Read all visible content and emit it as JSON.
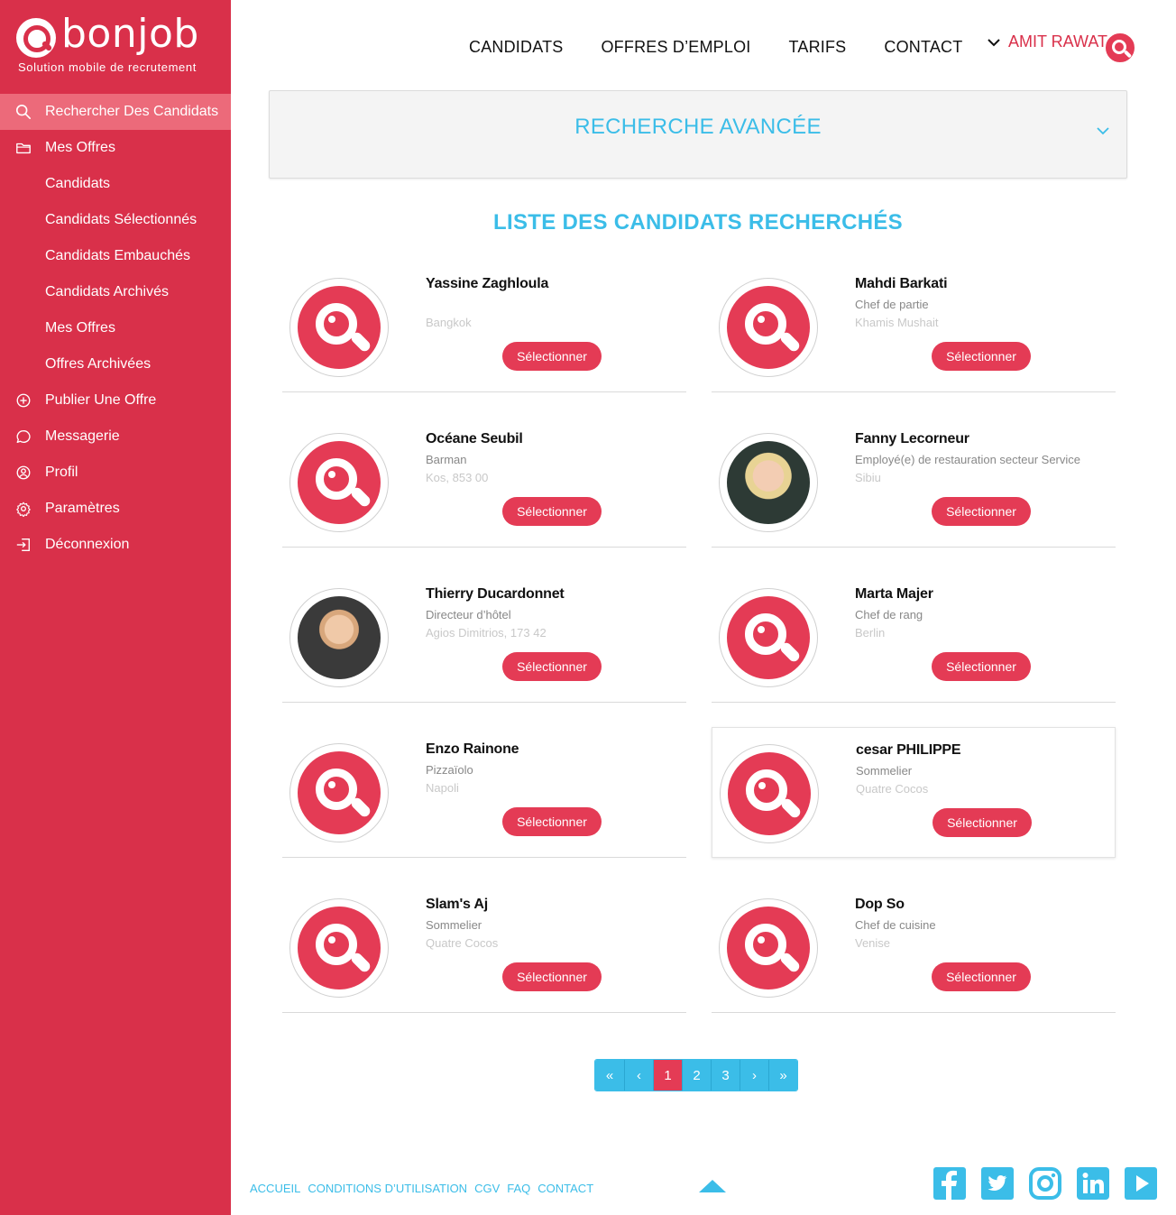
{
  "brand": {
    "name": "bonjob",
    "tagline": "Solution mobile de recrutement"
  },
  "sidebar": {
    "items": [
      {
        "label": "Rechercher Des Candidats",
        "icon": "search-icon"
      },
      {
        "label": "Mes Offres",
        "icon": "folder-icon"
      },
      {
        "label": "Candidats"
      },
      {
        "label": "Candidats Sélectionnés"
      },
      {
        "label": "Candidats Embauchés"
      },
      {
        "label": "Candidats Archivés"
      },
      {
        "label": "Mes Offres"
      },
      {
        "label": "Offres Archivées"
      },
      {
        "label": "Publier Une Offre",
        "icon": "plus-circle-icon"
      },
      {
        "label": "Messagerie",
        "icon": "chat-icon"
      },
      {
        "label": "Profil",
        "icon": "user-icon"
      },
      {
        "label": "Paramètres",
        "icon": "gear-icon"
      },
      {
        "label": "Déconnexion",
        "icon": "logout-icon"
      }
    ]
  },
  "topnav": {
    "links": [
      "CANDIDATS",
      "OFFRES D’EMPLOI",
      "TARIFS",
      "CONTACT"
    ],
    "user": "AMIT RAWAT"
  },
  "search": {
    "advanced_title": "RECHERCHE AVANCÉE"
  },
  "results": {
    "title": "LISTE DES CANDIDATS RECHERCHÉS",
    "select_label": "Sélectionner",
    "candidates": [
      {
        "name": "Yassine Zaghloula",
        "role": "",
        "location": "Bangkok"
      },
      {
        "name": "Mahdi Barkati",
        "role": "Chef de partie",
        "location": "Khamis Mushait"
      },
      {
        "name": "Océane Seubil",
        "role": "Barman",
        "location": "Kos, 853 00"
      },
      {
        "name": "Fanny Lecorneur",
        "role": "Employé(e) de restauration secteur Service",
        "location": "Sibiu"
      },
      {
        "name": "Thierry Ducardonnet",
        "role": "Directeur d’hôtel",
        "location": "Agios Dimitrios, 173 42"
      },
      {
        "name": "Marta Majer",
        "role": "Chef de rang",
        "location": "Berlin"
      },
      {
        "name": "Enzo Rainone",
        "role": "Pizzaïolo",
        "location": "Napoli"
      },
      {
        "name": "cesar PHILIPPE",
        "role": "Sommelier",
        "location": "Quatre Cocos"
      },
      {
        "name": "Slam's Aj",
        "role": "Sommelier",
        "location": "Quatre Cocos"
      },
      {
        "name": "Dop So",
        "role": "Chef de cuisine",
        "location": "Venise"
      }
    ]
  },
  "pagination": {
    "first": "«",
    "prev": "‹",
    "pages": [
      "1",
      "2",
      "3"
    ],
    "current": "1",
    "next": "›",
    "last": "»"
  },
  "footer": {
    "links": [
      "ACCUEIL",
      "CONDITIONS D’UTILISATION",
      "CGV",
      "FAQ",
      "CONTACT"
    ],
    "socials": [
      "facebook-icon",
      "twitter-icon",
      "instagram-icon",
      "linkedin-icon",
      "youtube-icon"
    ]
  },
  "colors": {
    "brand_red": "#d9304a",
    "accent_blue": "#3bbde8",
    "button_red": "#e43b55"
  }
}
